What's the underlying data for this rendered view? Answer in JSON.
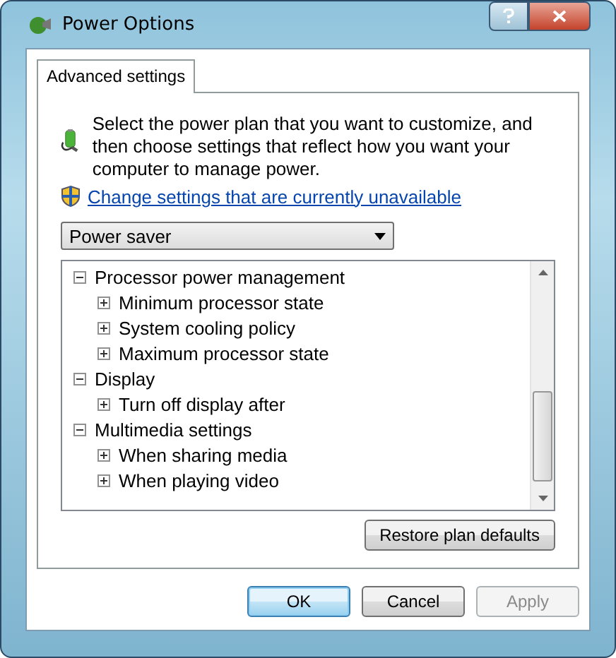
{
  "window": {
    "title": "Power Options"
  },
  "tabs": [
    {
      "label": "Advanced settings",
      "selected": true
    }
  ],
  "intro": "Select the power plan that you want to customize, and then choose settings that reflect how you want your computer to manage power.",
  "admin_link": "Change settings that are currently unavailable",
  "plan_dropdown": {
    "value": "Power saver"
  },
  "settings_tree": [
    {
      "label": "Processor power management",
      "expanded": true,
      "children": [
        {
          "label": "Minimum processor state",
          "expanded": false
        },
        {
          "label": "System cooling policy",
          "expanded": false
        },
        {
          "label": "Maximum processor state",
          "expanded": false
        }
      ]
    },
    {
      "label": "Display",
      "expanded": true,
      "children": [
        {
          "label": "Turn off display after",
          "expanded": false
        }
      ]
    },
    {
      "label": "Multimedia settings",
      "expanded": true,
      "children": [
        {
          "label": "When sharing media",
          "expanded": false
        },
        {
          "label": "When playing video",
          "expanded": false
        }
      ]
    }
  ],
  "restore_button": {
    "label": "Restore plan defaults"
  },
  "buttons": [
    {
      "label": "OK",
      "kind": "default",
      "disabled": false
    },
    {
      "label": "Cancel",
      "kind": "normal",
      "disabled": false
    },
    {
      "label": "Apply",
      "kind": "normal",
      "disabled": true
    }
  ]
}
